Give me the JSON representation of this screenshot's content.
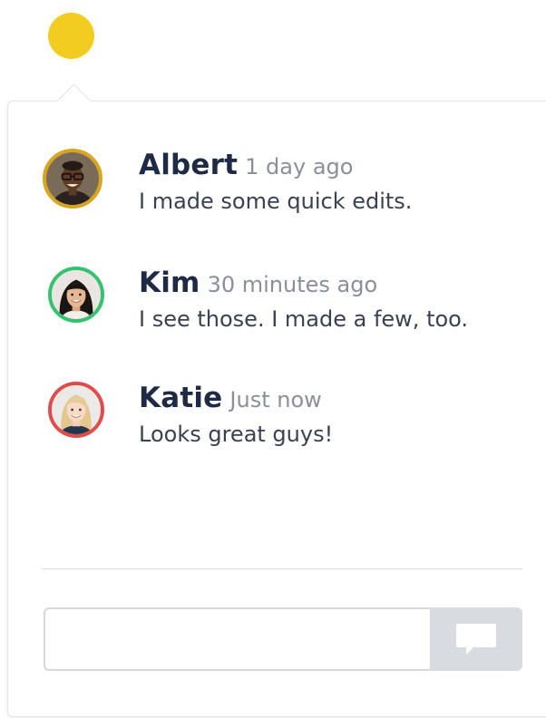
{
  "colors": {
    "marker": "#f2cd1f",
    "text_primary": "#1f2a44",
    "text_secondary": "#8a8f99",
    "send_button_bg": "#d8dbe0"
  },
  "comments": [
    {
      "author": "Albert",
      "time": "1 day ago",
      "message": "I made some quick edits.",
      "avatar_ring": "#d8a51e"
    },
    {
      "author": "Kim",
      "time": "30 minutes ago",
      "message": "I see those. I made a few, too.",
      "avatar_ring": "#34c26f"
    },
    {
      "author": "Katie",
      "time": "Just now",
      "message": "Looks great guys!",
      "avatar_ring": "#e24b4b"
    }
  ],
  "composer": {
    "value": "",
    "placeholder": "",
    "send_icon": "speech-bubble-icon"
  }
}
